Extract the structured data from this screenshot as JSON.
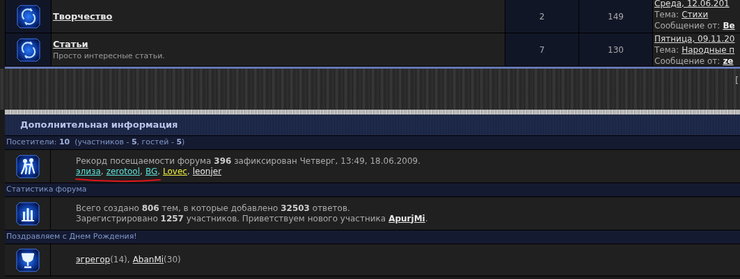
{
  "forums": [
    {
      "title": "Творчество",
      "topics": "2",
      "posts": "149",
      "last_post": {
        "date": "Среда, 12.06.201",
        "topic_label": "Тема:",
        "topic": "Стихи",
        "author_label": "Сообщение от:",
        "author": "Be"
      }
    },
    {
      "title": "Статьи",
      "description": "Просто интересные статьи.",
      "topics": "7",
      "posts": "130",
      "last_post": {
        "date": "Пятница, 09.11.20",
        "topic_label": "Тема:",
        "topic": "Народные п",
        "author_label": "Сообщение от:",
        "author": "ze"
      }
    }
  ],
  "pager_fragment": "[",
  "info": {
    "title": "Дополнительная информация",
    "sections": [
      {
        "kind": "online",
        "heading": "Посетители: **10**  (участников - **5**, гостей - **5**)",
        "text": "Рекорд посещаемости форума **396** зафиксирован Четверг, 13:49, 18.06.2009.",
        "users": [
          {
            "name": "элиза",
            "color": "#5ce0d8",
            "after": ",",
            "marked": true
          },
          {
            "name": "zerotool",
            "color": "#5ce0d8",
            "after": ",",
            "marked": true
          },
          {
            "name": "BG",
            "color": "#5ce0d8",
            "after": ",",
            "marked": true
          },
          {
            "name": "Lovec",
            "color": "#f0f040",
            "after": ",",
            "marked": false
          },
          {
            "name": "leonjer",
            "color": "#e6e6e6",
            "marked": false
          }
        ]
      },
      {
        "kind": "stats",
        "heading": "Статистика форума",
        "lines": [
          "Всего создано **806** тем, в которые добавлено **32503** ответов."
        ],
        "greeting": "Зарегистрировано **1257** участников. Приветствуем нового участника",
        "newest_member": "ApurjMi",
        "greeting_end": "."
      },
      {
        "kind": "birthdays",
        "heading": "Поздравляем с Днем Рождения!",
        "users": [
          {
            "name": "эгрегор",
            "age": "(14)",
            "after": ","
          },
          {
            "name": "AbanMi",
            "age": "(30)"
          }
        ]
      }
    ]
  }
}
